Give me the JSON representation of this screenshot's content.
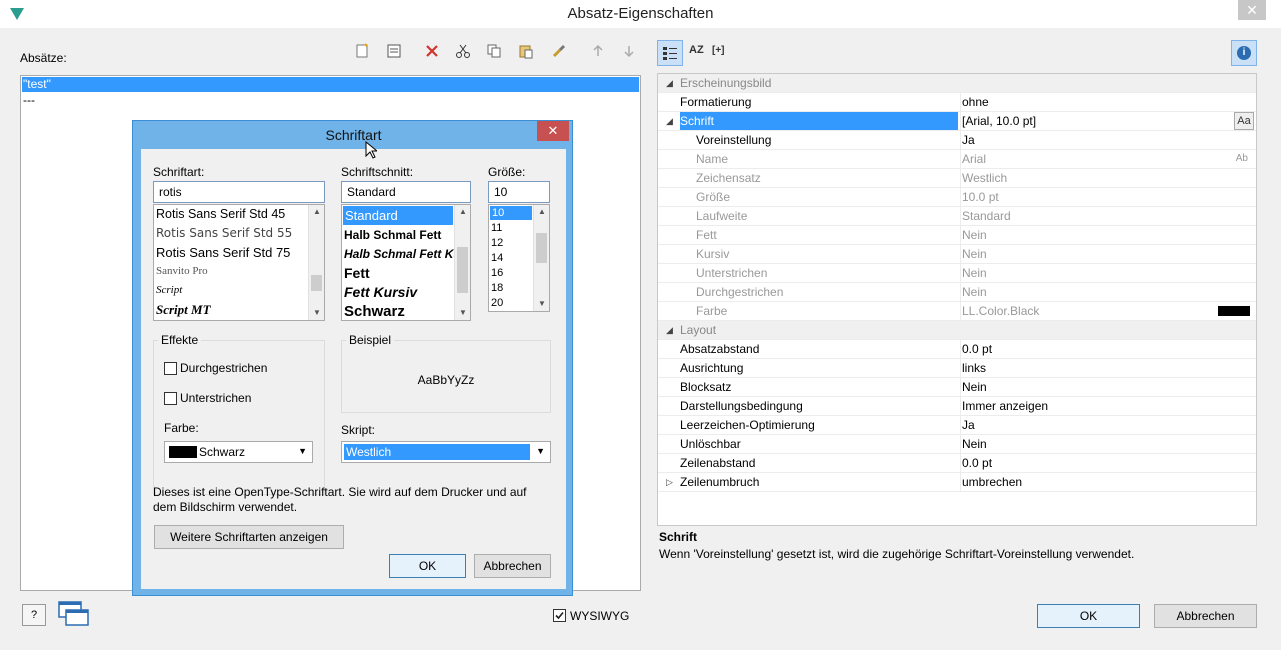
{
  "window": {
    "title": "Absatz-Eigenschaften",
    "close": "✕"
  },
  "left": {
    "label": "Absätze:",
    "items": [
      "\"test\"",
      "---"
    ]
  },
  "toolbar_icons": [
    "new-icon",
    "edit-icon",
    "delete-icon",
    "cut-icon",
    "copy-icon",
    "paste-icon",
    "brush-icon",
    "arrow-up-icon",
    "arrow-down-icon"
  ],
  "prop_toolbar": {
    "sort": "AZ",
    "expand": "[+]",
    "info": "i"
  },
  "properties": {
    "rows": [
      {
        "k": "Erscheinungsbild",
        "v": "",
        "type": "cat",
        "tri": "◢"
      },
      {
        "k": "Formatierung",
        "v": "ohne",
        "type": ""
      },
      {
        "k": "Schrift",
        "v": "[Arial, 10.0 pt]",
        "type": "hl",
        "tri": "◢"
      },
      {
        "k": "Voreinstellung",
        "v": "Ja",
        "type": "sub"
      },
      {
        "k": "Name",
        "v": "Arial",
        "type": "sub dim"
      },
      {
        "k": "Zeichensatz",
        "v": "Westlich",
        "type": "sub dim"
      },
      {
        "k": "Größe",
        "v": "10.0 pt",
        "type": "sub dim"
      },
      {
        "k": "Laufweite",
        "v": "Standard",
        "type": "sub dim"
      },
      {
        "k": "Fett",
        "v": "Nein",
        "type": "sub dim"
      },
      {
        "k": "Kursiv",
        "v": "Nein",
        "type": "sub dim"
      },
      {
        "k": "Unterstrichen",
        "v": "Nein",
        "type": "sub dim"
      },
      {
        "k": "Durchgestrichen",
        "v": "Nein",
        "type": "sub dim"
      },
      {
        "k": "Farbe",
        "v": "LL.Color.Black",
        "type": "sub dim"
      },
      {
        "k": "Layout",
        "v": "",
        "type": "cat",
        "tri": "◢"
      },
      {
        "k": "Absatzabstand",
        "v": "0.0 pt",
        "type": ""
      },
      {
        "k": "Ausrichtung",
        "v": "links",
        "type": ""
      },
      {
        "k": "Blocksatz",
        "v": "Nein",
        "type": ""
      },
      {
        "k": "Darstellungsbedingung",
        "v": "Immer anzeigen",
        "type": ""
      },
      {
        "k": "Leerzeichen-Optimierung",
        "v": "Ja",
        "type": ""
      },
      {
        "k": "Unlöschbar",
        "v": "Nein",
        "type": ""
      },
      {
        "k": "Zeilenabstand",
        "v": "0.0 pt",
        "type": ""
      },
      {
        "k": "Zeilenumbruch",
        "v": "umbrechen",
        "type": "",
        "tri": "▷"
      }
    ],
    "font_button": "Aa",
    "name_icon": "Ab"
  },
  "description": {
    "title": "Schrift",
    "text": "Wenn 'Voreinstellung' gesetzt ist, wird die zugehörige Schriftart-Voreinstellung verwendet."
  },
  "bottom": {
    "help": "?",
    "wysiwyg": "WYSIWYG",
    "ok": "OK",
    "cancel": "Abbrechen"
  },
  "font_dialog": {
    "title": "Schriftart",
    "close": "✕",
    "font_label": "Schriftart:",
    "font_value": "rotis",
    "fonts": [
      "Rotis Sans Serif Std 45",
      "Rotis Sans Serif Std 55",
      "Rotis Sans Serif Std 75",
      "Sanvito Pro",
      "Script",
      "Script MT"
    ],
    "style_label": "Schriftschnitt:",
    "style_value": "Standard",
    "styles": [
      "Standard",
      "Halb Schmal Fett",
      "Halb Schmal Fett Kursiv",
      "Fett",
      "Fett Kursiv",
      "Schwarz"
    ],
    "size_label": "Größe:",
    "size_value": "10",
    "sizes": [
      "10",
      "11",
      "12",
      "14",
      "16",
      "18",
      "20"
    ],
    "effects_label": "Effekte",
    "strike": "Durchgestrichen",
    "underline": "Unterstrichen",
    "color_label": "Farbe:",
    "color_value": "Schwarz",
    "sample_label": "Beispiel",
    "sample_text": "AaBbYyZz",
    "script_label": "Skript:",
    "script_value": "Westlich",
    "info": "Dieses ist eine OpenType-Schriftart. Sie wird auf dem Drucker und auf dem Bildschirm verwendet.",
    "more_fonts": "Weitere Schriftarten anzeigen",
    "ok": "OK",
    "cancel": "Abbrechen"
  },
  "colors": {
    "accent": "#3399ff",
    "dialog_border": "#6fb3e8",
    "close_red": "#c75050"
  }
}
